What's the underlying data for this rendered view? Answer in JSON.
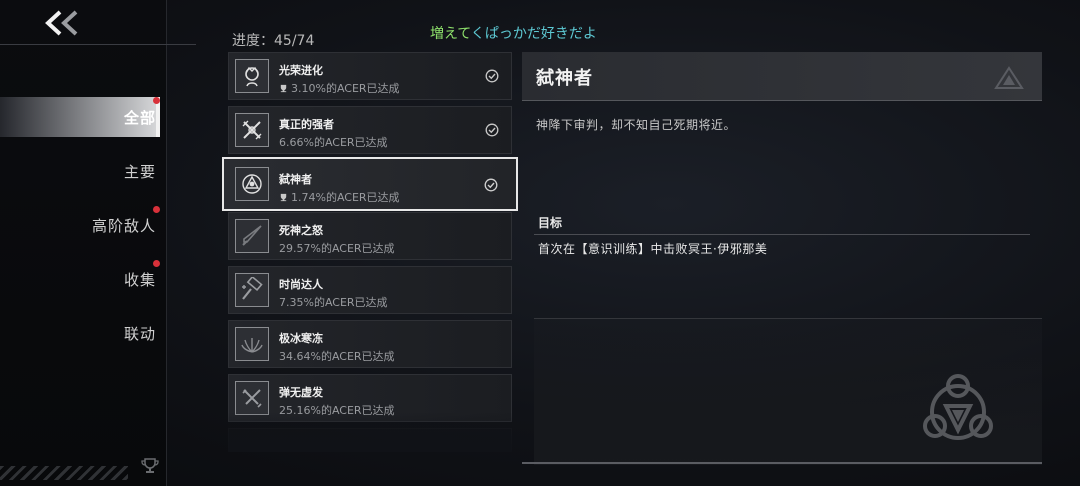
{
  "header": {
    "progress": "进度：45/74",
    "banner_part1": "増えて",
    "banner_part2": "くぱっかだ好きだよ"
  },
  "sidebar": {
    "tabs": [
      {
        "label": "全部",
        "active": true,
        "has_dot": true
      },
      {
        "label": "主要",
        "active": false,
        "has_dot": false
      },
      {
        "label": "高阶敌人",
        "active": false,
        "has_dot": true
      },
      {
        "label": "收集",
        "active": false,
        "has_dot": true
      },
      {
        "label": "联动",
        "active": false,
        "has_dot": false
      }
    ]
  },
  "achievements": [
    {
      "title": "光荣进化",
      "rate": "3.10%的ACER已达成",
      "unlocked": true,
      "icon": "face-badge-icon"
    },
    {
      "title": "真正的强者",
      "rate": "6.66%的ACER已达成",
      "unlocked": true,
      "icon": "crossed-weapons-icon"
    },
    {
      "title": "弑神者",
      "rate": "1.74%的ACER已达成",
      "unlocked": true,
      "selected": true,
      "icon": "triangle-sigil-icon"
    },
    {
      "title": "死神之怒",
      "rate": "29.57%的ACER已达成",
      "unlocked": false,
      "icon": "blade-icon"
    },
    {
      "title": "时尚达人",
      "rate": "7.35%的ACER已达成",
      "unlocked": false,
      "icon": "hammer-icon"
    },
    {
      "title": "极冰寒冻",
      "rate": "34.64%的ACER已达成",
      "unlocked": false,
      "icon": "ice-flower-icon"
    },
    {
      "title": "弹无虚发",
      "rate": "25.16%的ACER已达成",
      "unlocked": false,
      "icon": "crossed-guns-icon"
    }
  ],
  "detail": {
    "title": "弑神者",
    "description": "神降下审判，却不知自己死期将近。",
    "goal_label": "目标",
    "goal_text": "首次在【意识训练】中击败冥王·伊邪那美"
  },
  "colors": {
    "accent_dot": "#d8313a",
    "banner_green": "#8fe26c",
    "banner_cyan": "#5dc8d2"
  }
}
